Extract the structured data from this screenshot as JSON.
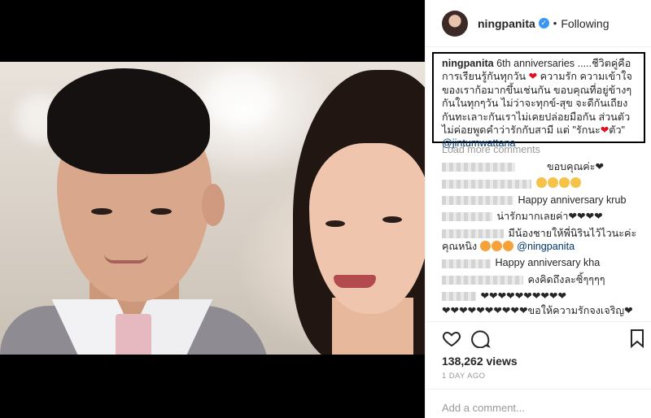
{
  "post": {
    "username": "ningpanita",
    "follow_separator": "•",
    "follow_status": "Following"
  },
  "caption": {
    "username": "ningpanita",
    "text_1": " 6th anniversaries .....ชีวิตคู่คือการเรียนรู้กันทุกวัน ",
    "heart": "❤",
    "text_2": " ความรัก ความเข้าใจของเราก้อมากขึ้นเช่นกัน ขอบคุณที่อยู่ข้างๆกันในทุกๆวัน ไม่ว่าจะทุกข์-สุข จะดีกันเถียงกันทะเลาะกันเราไม่เคยปล่อยมือกัน ส่วนตัวไม่ค่อยพูดคำว่ารักกับสามี แต่ \"รักนะ",
    "text_3": "ตัว\" ",
    "mention": "@jintumwattana"
  },
  "load_more_label": "Load more comments",
  "comments": [
    {
      "text": "ขอบคุณค่ะ❤"
    },
    {
      "text": ""
    },
    {
      "text": "Happy anniversary krub"
    },
    {
      "text": "น่ารักมากเลยค่า❤❤❤❤"
    },
    {
      "text": "มีน้องชายให้พี่นิรินไว้ไวนะค่ะคุณหนิง",
      "mention": "@ningpanita"
    },
    {
      "text": "Happy anniversary kha"
    },
    {
      "text": "คงคิดถึงละซิ้ๆๆๆๆ"
    },
    {
      "text": "❤❤❤❤❤❤❤❤❤❤"
    },
    {
      "text": "❤❤❤❤❤❤❤❤❤❤ขอให้ความรักจงเจริญ❤"
    }
  ],
  "stats": {
    "views": "138,262 views",
    "date": "1 DAY AGO"
  },
  "add_comment": {
    "placeholder": "Add a comment..."
  },
  "colors": {
    "verified": "#3897f0",
    "mention": "#003569",
    "heart": "#e0111d",
    "caption_border": "#000000"
  }
}
